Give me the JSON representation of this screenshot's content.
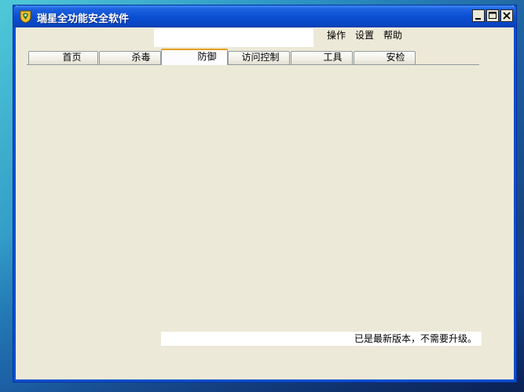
{
  "window": {
    "title": "瑞星全功能安全软件",
    "controls": {
      "minimize_icon": "minimize-icon",
      "maximize_icon": "maximize-icon",
      "close_icon": "close-icon"
    }
  },
  "menu": [
    {
      "label": "操作"
    },
    {
      "label": "设置"
    },
    {
      "label": "帮助"
    }
  ],
  "tabs": [
    {
      "label": "首页",
      "active": false
    },
    {
      "label": "杀毒",
      "active": false
    },
    {
      "label": "防御",
      "active": true
    },
    {
      "label": "访问控制",
      "active": false
    },
    {
      "label": "工具",
      "active": false
    },
    {
      "label": "安检",
      "active": false
    }
  ],
  "status": {
    "message": "已是最新版本，不需要升级。"
  },
  "colors": {
    "titlebar": "#0b4fd4",
    "window_bg": "#ece9d8",
    "active_tab_accent": "#e6a020"
  }
}
